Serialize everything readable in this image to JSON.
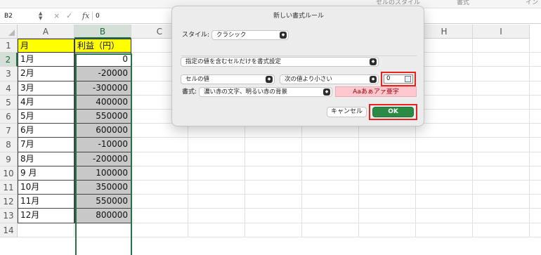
{
  "ribbon": {
    "items": [
      "セルのスタイル",
      "書式",
      "イン"
    ]
  },
  "formula_bar": {
    "name_box": "B2",
    "cancel_icon": "×",
    "enter_icon": "✓",
    "fx_label": "fx",
    "value": "0"
  },
  "sheet": {
    "columns": [
      "A",
      "B",
      "C",
      "D",
      "E",
      "F",
      "G",
      "H",
      "I"
    ],
    "rows": [
      "1",
      "2",
      "3",
      "4",
      "5",
      "6",
      "7",
      "8",
      "9",
      "10",
      "11",
      "12",
      "13",
      "14"
    ],
    "header_month": "月",
    "header_profit": "利益（円）",
    "months": [
      "1月",
      "2月",
      "3月",
      "4月",
      "5月",
      "6月",
      "7月",
      "8月",
      "9 月",
      "10月",
      "11月",
      "12月"
    ],
    "profits": [
      "0",
      "-20000",
      "-300000",
      "400000",
      "550000",
      "600000",
      "-10000",
      "-200000",
      "100000",
      "350000",
      "550000",
      "800000"
    ],
    "highlight_color": "#ffff00",
    "format_fill_color": "#c8c8c8",
    "selection_color": "#217346"
  },
  "dialog": {
    "title": "新しい書式ルール",
    "style_label": "スタイル:",
    "style_value": "クラシック",
    "rule_type": "指定の値を含むセルだけを書式設定",
    "condition_target": "セルの値",
    "condition_operator": "次の値より小さい",
    "condition_value": "0",
    "format_label": "書式:",
    "format_value": "濃い赤の文字、明るい赤の背景",
    "preview_text": "Aaあぁアァ亜宇",
    "cancel_label": "キャンセル",
    "ok_label": "OK",
    "ok_color": "#2d8a44",
    "highlight_border_color": "#e8231b"
  }
}
